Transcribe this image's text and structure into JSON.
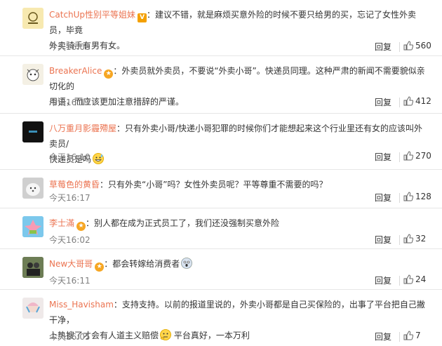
{
  "reply_label": "回复",
  "comments": [
    {
      "name": "CatchUp性别平等姐妹",
      "badge": "V",
      "text1": "：建议不错，就是麻烦买意外险的时候不要只给男的买，忘记了女性外卖员，毕竟",
      "text2": "外卖骑手有男有女。",
      "time": "今天16:08",
      "likes": "560",
      "avatar": "catchup-logo-avatar"
    },
    {
      "name": "BreakerAlice",
      "badge": "star",
      "text1": "：外卖员就外卖员，不要说“外卖小哥”。快递员同理。这种严肃的新闻不需要貌似亲切化的",
      "text2": "用语，而应该更加注意措辞的严谨。",
      "time": "今天16:17",
      "likes": "412",
      "avatar": "cartoon-avatar"
    },
    {
      "name": "八万重月影霾殢屋",
      "text1": "：只有外卖小哥/快递小哥犯罪的时候你们才能想起来这个行业里还有女的应该叫外卖员/",
      "text2": "快递员是吗",
      "time": "今天16:10",
      "likes": "270",
      "avatar": "dark-avatar"
    },
    {
      "name": "草莓色的黄昏",
      "text1": "：只有外卖“小哥”吗？女性外卖员呢？平等尊重不需要的吗？",
      "time": "今天16:17",
      "likes": "128",
      "avatar": "white-dog-avatar"
    },
    {
      "name": "李士滿",
      "badge": "star",
      "text1": "：别人都在成为正式员工了，我们还没强制买意外险",
      "time": "今天16:02",
      "likes": "32",
      "avatar": "patrick-avatar"
    },
    {
      "name": "New大哥哥",
      "badge": "star",
      "text1": "：都会转嫁给消费者",
      "time": "今天16:11",
      "likes": "24",
      "avatar": "couple-avatar"
    },
    {
      "name": "Miss_Havisham",
      "text1": "：支持支持。以前的报道里说的，外卖小哥都是自己买保险的，出事了平台把自己撇干净，",
      "text2a": "上热搜了才会有人道主义赔偿",
      "text2b": "平台真好，一本万利",
      "time": "今天16:05",
      "likes": "7",
      "avatar": "harley-avatar"
    }
  ],
  "colors": {
    "name": "#eb7350",
    "text": "#333333",
    "meta": "#808080",
    "divider": "#e6e6e6"
  }
}
